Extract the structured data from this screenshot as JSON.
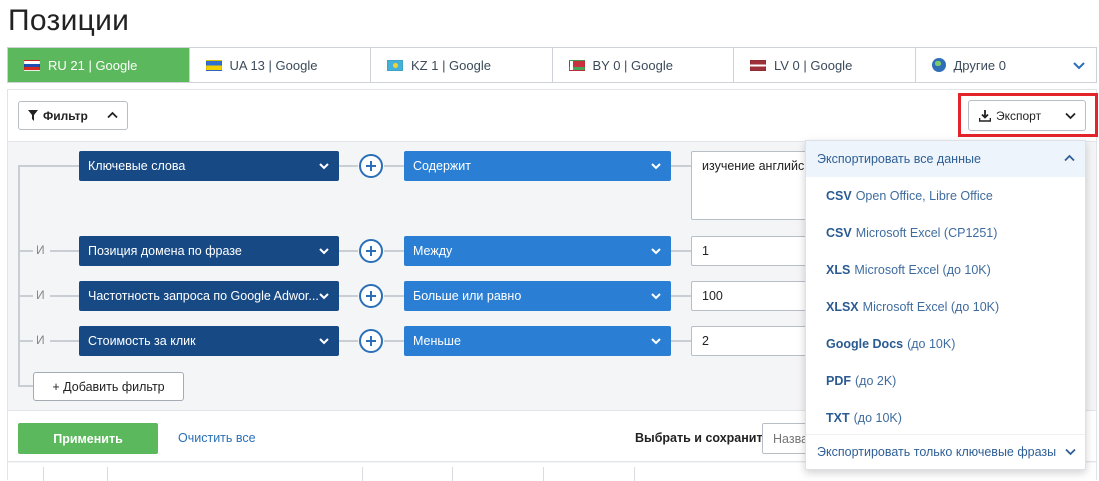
{
  "page": {
    "title": "Позиции"
  },
  "tabs": [
    {
      "label": "RU 21 | Google",
      "flag": "ru",
      "active": true
    },
    {
      "label": "UA 13 | Google",
      "flag": "ua",
      "active": false
    },
    {
      "label": "KZ 1 | Google",
      "flag": "kz",
      "active": false
    },
    {
      "label": "BY 0 | Google",
      "flag": "by",
      "active": false
    },
    {
      "label": "LV 0 | Google",
      "flag": "lv",
      "active": false
    },
    {
      "label": "Другие 0",
      "flag": "globe-icon",
      "active": false
    }
  ],
  "toolbar": {
    "filter_label": "Фильтр",
    "export_label": "Экспорт"
  },
  "filters": [
    {
      "connector": "",
      "field": "Ключевые слова",
      "operator": "Содержит",
      "value": "изучение английского"
    },
    {
      "connector": "И",
      "field": "Позиция домена по фразе",
      "operator": "Между",
      "value": "1"
    },
    {
      "connector": "И",
      "field": "Частотность запроса по Google Adwor...",
      "operator": "Больше или равно",
      "value": "100"
    },
    {
      "connector": "И",
      "field": "Стоимость за клик",
      "operator": "Меньше",
      "value": "2"
    }
  ],
  "add_filter_label": "+ Добавить фильтр",
  "actions": {
    "apply": "Применить",
    "clear": "Очистить все",
    "save_label": "Выбрать и сохранить",
    "save_placeholder": "Назва"
  },
  "export_menu": {
    "header": "Экспортировать все данные",
    "items": [
      {
        "format": "CSV",
        "detail": "Open Office, Libre Office"
      },
      {
        "format": "CSV",
        "detail": "Microsoft Excel (CP1251)"
      },
      {
        "format": "XLS",
        "detail": "Microsoft Excel (до 10K)"
      },
      {
        "format": "XLSX",
        "detail": "Microsoft Excel (до 10K)"
      },
      {
        "format": "Google Docs",
        "detail": "(до 10K)"
      },
      {
        "format": "PDF",
        "detail": "(до 2K)"
      },
      {
        "format": "TXT",
        "detail": "(до 10K)"
      }
    ],
    "footer": "Экспортировать только ключевые фразы"
  },
  "colors": {
    "active_tab": "#5cb85c",
    "field_select": "#174a85",
    "operator_select": "#2a7fd4",
    "highlight": "#e3242b",
    "link": "#2a6fb7"
  }
}
